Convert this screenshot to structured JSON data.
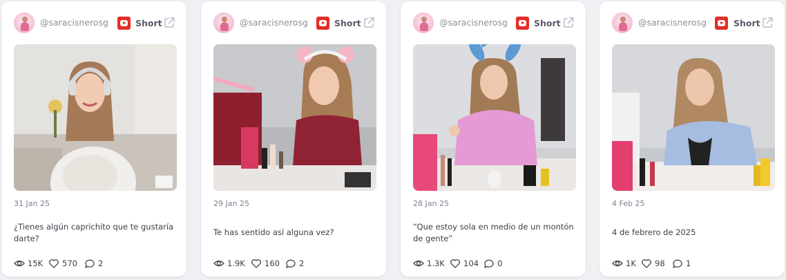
{
  "cards": [
    {
      "handle": "@saracisnerosg",
      "platform_icon": "youtube-icon",
      "type": "Short",
      "date": "31 Jan 25",
      "caption": "¿Tienes algún caprichito que te gustaría darte?",
      "views": "15K",
      "likes": "570",
      "comments": "2",
      "thumbnail": "woman-with-headphones-in-bedroom"
    },
    {
      "handle": "@saracisnerosg",
      "platform_icon": "youtube-icon",
      "type": "Short",
      "date": "29 Jan 25",
      "caption": "Te has sentido así alguna vez?",
      "views": "1.9K",
      "likes": "160",
      "comments": "2",
      "thumbnail": "woman-applying-lipstick-red-sweater"
    },
    {
      "handle": "@saracisnerosg",
      "platform_icon": "youtube-icon",
      "type": "Short",
      "date": "28 Jan 25",
      "caption": "“Que estoy sola en medio de un montón de gente”",
      "views": "1.3K",
      "likes": "104",
      "comments": "0",
      "thumbnail": "woman-bunny-ears-pink-hoodie"
    },
    {
      "handle": "@saracisnerosg",
      "platform_icon": "youtube-icon",
      "type": "Short",
      "date": "4 Feb 25",
      "caption": "4 de febrero de 2025",
      "views": "1K",
      "likes": "98",
      "comments": "1",
      "thumbnail": "woman-blue-top-makeup-table"
    }
  ],
  "colors": {
    "youtube_red": "#e52d27",
    "card_bg": "#ffffff",
    "page_bg": "#eef0f4",
    "muted_text": "#8a8f99"
  }
}
